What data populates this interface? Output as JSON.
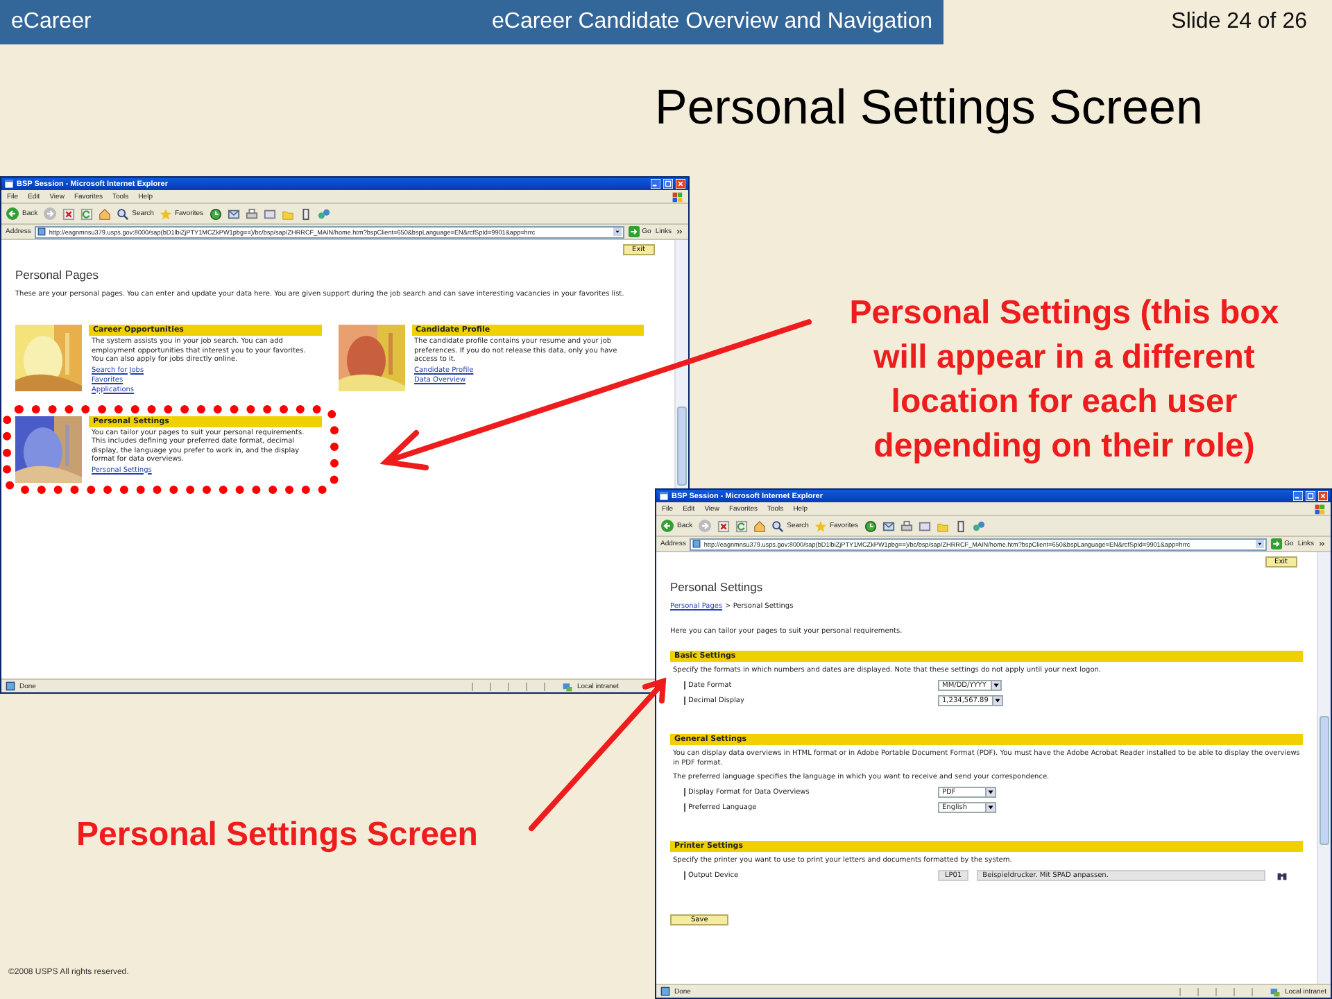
{
  "header": {
    "left": "eCareer",
    "center": "eCareer Candidate Overview and Navigation",
    "slide_number": "Slide 24 of 26"
  },
  "title": "Personal Settings Screen",
  "windows": [
    {
      "kind": "home",
      "title": "BSP Session - Microsoft Internet Explorer",
      "menu": [
        "File",
        "Edit",
        "View",
        "Favorites",
        "Tools",
        "Help"
      ],
      "toolbar": {
        "back": "Back",
        "search": "Search",
        "favorites": "Favorites"
      },
      "address_label": "Address",
      "url": "http://eagnmnsu379.usps.gov:8000/sap(bD1lbiZjPTY1MCZkPW1pbg==)/bc/bsp/sap/ZHRRCF_MAIN/home.htm?bspClient=650&bspLanguage=EN&rcfSpId=9901&app=hrrc",
      "go": "Go",
      "links": "Links",
      "exit": "Exit",
      "status": "Done",
      "zone": "Local intranet",
      "page": {
        "heading": "Personal Pages",
        "intro": "These are your personal pages. You can enter and update your data here. You are given support during the job search and can save interesting vacancies in your favorites list.",
        "cards": [
          {
            "title": "Career Opportunities",
            "text": "The system assists you in your job search. You can add employment opportunities that interest you to your favorites. You can also apply for jobs directly online.",
            "links": [
              "Search for Jobs",
              "Favorites",
              "Applications"
            ],
            "highlighted": false
          },
          {
            "title": "Candidate Profile",
            "text": "The candidate profile contains your resume and your job preferences. If you do not release this data, only you have access to it.",
            "links": [
              "Candidate Profile",
              "Data Overview"
            ],
            "highlighted": false
          },
          {
            "title": "Personal Settings",
            "text": "You can tailor your pages to suit your personal requirements. This includes defining your preferred date format, decimal display, the language you prefer to work in, and the display format for data overviews.",
            "links": [
              "Personal Settings"
            ],
            "highlighted": true
          }
        ]
      }
    },
    {
      "kind": "settings",
      "title": "BSP Session - Microsoft Internet Explorer",
      "menu": [
        "File",
        "Edit",
        "View",
        "Favorites",
        "Tools",
        "Help"
      ],
      "toolbar": {
        "back": "Back",
        "search": "Search",
        "favorites": "Favorites"
      },
      "address_label": "Address",
      "url": "http://eagnmnsu379.usps.gov:8000/sap(bD1lbiZjPTY1MCZkPW1pbg==)/bc/bsp/sap/ZHRRCF_MAIN/home.htm?bspClient=650&bspLanguage=EN&rcfSpId=9901&app=hrrc",
      "go": "Go",
      "links": "Links",
      "exit": "Exit",
      "status": "Done",
      "zone": "Local intranet",
      "page": {
        "heading": "Personal Settings",
        "breadcrumb": {
          "link": "Personal Pages",
          "rest": "> Personal Settings"
        },
        "intro": "Here you can tailor your pages to suit your personal requirements.",
        "sections": [
          {
            "title": "Basic Settings",
            "notes": [
              "Specify the formats in which numbers and dates are displayed. Note that these settings do not apply until your next logon."
            ],
            "fields": [
              {
                "label": "Date Format",
                "kind": "dropdown",
                "value": "MM/DD/YYYY"
              },
              {
                "label": "Decimal Display",
                "kind": "dropdown",
                "value": "1,234,567.89"
              }
            ]
          },
          {
            "title": "General Settings",
            "notes": [
              "You can display data overviews in HTML format or in Adobe Portable Document Format (PDF). You must have the Adobe Acrobat Reader installed to be able to display the overviews in PDF format.",
              "The preferred language specifies the language in which you want to receive and send your correspondence."
            ],
            "fields": [
              {
                "label": "Display Format for Data Overviews",
                "kind": "dropdown",
                "value": "PDF"
              },
              {
                "label": "Preferred Language",
                "kind": "dropdown",
                "value": "English"
              }
            ]
          },
          {
            "title": "Printer Settings",
            "notes": [
              "Specify the printer you want to use to print your letters and documents formatted by the system."
            ],
            "fields": [
              {
                "label": "Output Device",
                "kind": "lookup",
                "value": "LP01",
                "description": "Beispieldrucker. Mit SPAD anpassen."
              }
            ]
          }
        ],
        "save": "Save"
      }
    }
  ],
  "callout": "Personal Settings (this box will appear in a different location for each user depending on their role)",
  "caption": "Personal Settings Screen",
  "footer": "©2008 USPS All rights reserved."
}
